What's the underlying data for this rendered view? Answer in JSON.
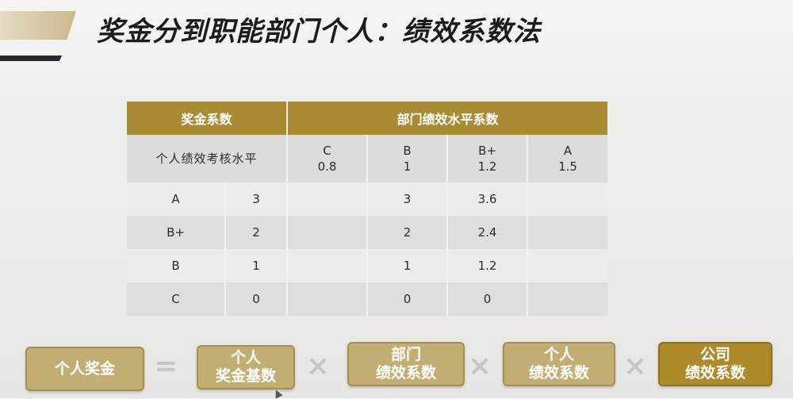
{
  "slide": {
    "title": "奖金分到职能部门个人：绩效系数法"
  },
  "table": {
    "header_left": "奖金系数",
    "header_right": "部门绩效水平系数",
    "subheader_label": "个人绩效考核水平",
    "dept_levels": [
      {
        "grade": "C",
        "coef": "0.8"
      },
      {
        "grade": "B",
        "coef": "1"
      },
      {
        "grade": "B+",
        "coef": "1.2"
      },
      {
        "grade": "A",
        "coef": "1.5"
      }
    ],
    "rows": [
      {
        "grade": "A",
        "coef": "3",
        "cells": [
          "",
          "3",
          "3.6",
          ""
        ]
      },
      {
        "grade": "B+",
        "coef": "2",
        "cells": [
          "",
          "2",
          "2.4",
          ""
        ]
      },
      {
        "grade": "B",
        "coef": "1",
        "cells": [
          "",
          "1",
          "1.2",
          ""
        ]
      },
      {
        "grade": "C",
        "coef": "0",
        "cells": [
          "",
          "0",
          "0",
          ""
        ]
      }
    ]
  },
  "formula": {
    "result": "个人奖金",
    "equals": "=",
    "times": "×",
    "term1_line1": "个人",
    "term1_line2": "奖金基数",
    "term2_line1": "部门",
    "term2_line2": "绩效系数",
    "term3_line1": "个人",
    "term3_line2": "绩效系数",
    "term4_line1": "公司",
    "term4_line2": "绩效系数"
  },
  "colors": {
    "gold_header": "#a88b32",
    "gold_button": "#c2ad72",
    "gold_dark_button": "#ae8a2a"
  }
}
